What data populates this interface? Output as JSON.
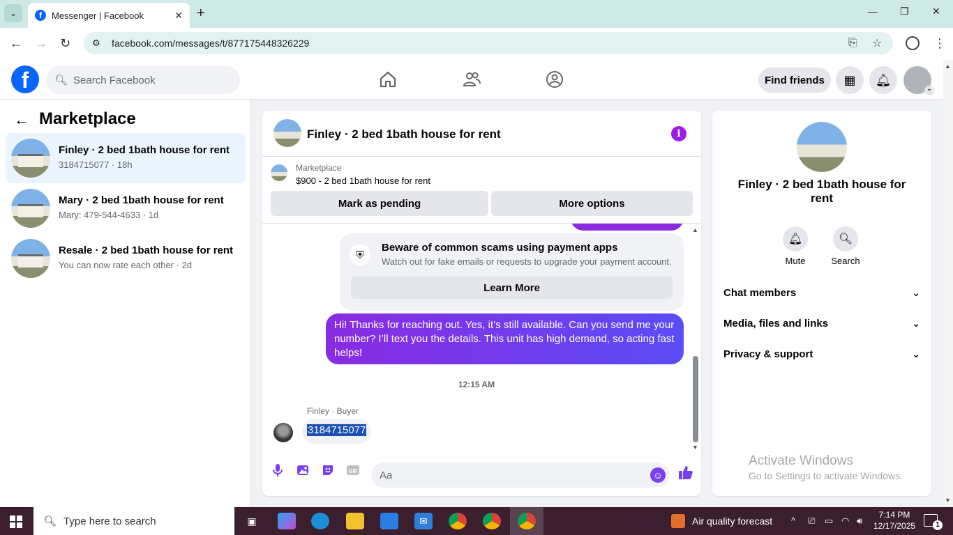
{
  "browser": {
    "tab_title": "Messenger | Facebook",
    "url": "facebook.com/messages/t/877175448326229"
  },
  "fb": {
    "search_placeholder": "Search Facebook",
    "find_friends": "Find friends"
  },
  "left": {
    "title": "Marketplace",
    "conversations": [
      {
        "name": "Finley · 2 bed 1bath house for rent",
        "sub": "3184715077 · 18h"
      },
      {
        "name": "Mary · 2 bed 1bath house for rent",
        "sub": "Mary: 479-544-4633 · 1d"
      },
      {
        "name": "Resale · 2 bed 1bath house for rent",
        "sub": "You can now rate each other · 2d"
      }
    ]
  },
  "chat": {
    "title": "Finley · 2 bed 1bath house for rent",
    "marketplace_label": "Marketplace",
    "listing": "$900 - 2 bed 1bath house for rent",
    "mark_pending": "Mark as pending",
    "more_options": "More options",
    "scam_title": "Beware of common scams using payment apps",
    "scam_text": "Watch out for fake emails or requests to upgrade your payment account.",
    "learn_more": "Learn More",
    "outgoing_message": "Hi! Thanks for reaching out. Yes, it’s still available. Can you send me your number? I’ll text you the details. This unit has high demand, so acting fast helps!",
    "timestamp": "12:15 AM",
    "sender_label": "Finley · Buyer",
    "incoming_message": "3184715077",
    "composer_placeholder": "Aa"
  },
  "right": {
    "name": "Finley · 2 bed 1bath house for rent",
    "mute": "Mute",
    "search": "Search",
    "sections": [
      "Chat members",
      "Media, files and links",
      "Privacy & support"
    ]
  },
  "watermark": {
    "line1": "Activate Windows",
    "line2": "Go to Settings to activate Windows."
  },
  "taskbar": {
    "search_placeholder": "Type here to search",
    "weather": "Air quality forecast",
    "time": "7:14 PM",
    "date": "12/17/2025",
    "notifications": "1"
  },
  "colors": {
    "fb_blue": "#0866ff",
    "messenger_purple": "#7b3ff2",
    "taskbar": "#3b1f2f"
  }
}
